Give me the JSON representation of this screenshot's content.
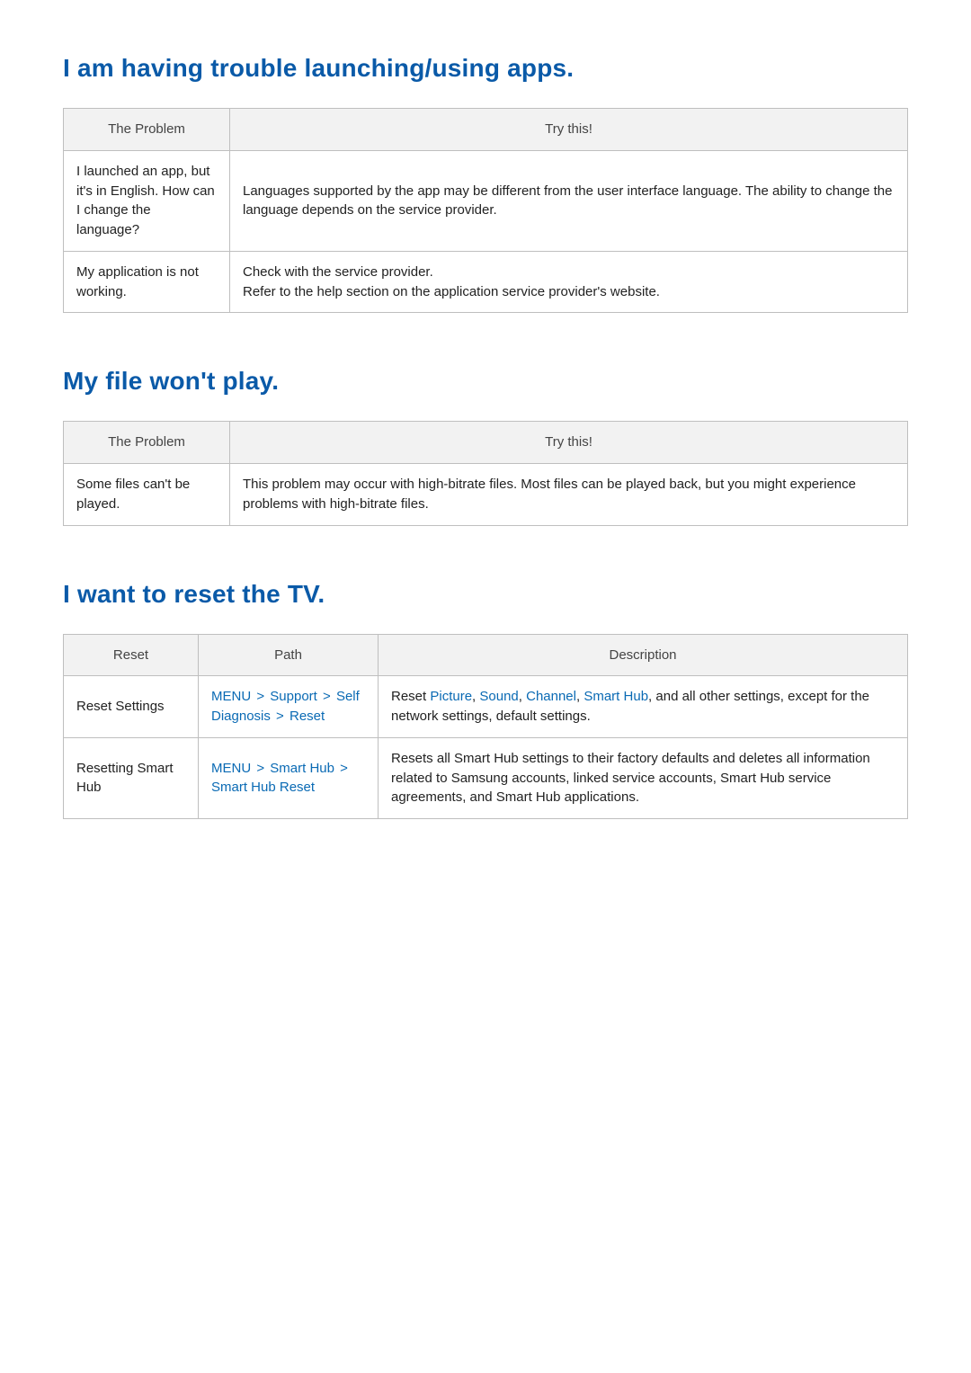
{
  "sections": [
    {
      "heading": "I am having trouble launching/using apps.",
      "headers": [
        "The Problem",
        "Try this!"
      ],
      "rows": [
        {
          "problem": "I launched an app, but it's in English. How can I change the language?",
          "answer": "Languages supported by the app may be different from the user interface language. The ability to change the language depends on the service provider."
        },
        {
          "problem": "My application is not working.",
          "answer": "Check with the service provider.\nRefer to the help section on the application service provider's website."
        }
      ]
    },
    {
      "heading": "My file won't play.",
      "headers": [
        "The Problem",
        "Try this!"
      ],
      "rows": [
        {
          "problem": "Some files can't be played.",
          "answer": "This problem may occur with high-bitrate files. Most files can be played back, but you might experience problems with high-bitrate files."
        }
      ]
    }
  ],
  "resetSection": {
    "heading": "I want to reset the TV.",
    "headers": [
      "Reset",
      "Path",
      "Description"
    ],
    "rows": [
      {
        "reset": "Reset Settings",
        "pathParts": [
          "MENU",
          "Support",
          "Self Diagnosis",
          "Reset"
        ],
        "descPrefix": "Reset ",
        "descLinks": [
          "Picture",
          "Sound",
          "Channel",
          "Smart Hub"
        ],
        "descSuffix": ", and all other settings, except for the network settings, default settings."
      },
      {
        "reset": "Resetting Smart Hub",
        "pathParts": [
          "MENU",
          "Smart Hub",
          "Smart Hub Reset"
        ],
        "descPlain": "Resets all Smart Hub settings to their factory defaults and deletes all information related to Samsung accounts, linked service accounts, Smart Hub service agreements, and Smart Hub applications."
      }
    ]
  }
}
